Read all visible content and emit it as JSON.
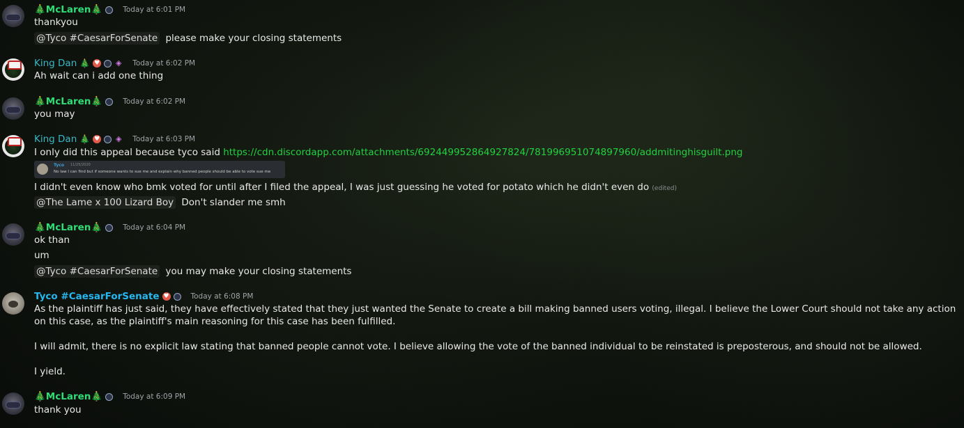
{
  "users": {
    "mclaren": {
      "name": "🎄McLaren🎄",
      "color": "#2fdc75"
    },
    "kingdan": {
      "name": "King Dan",
      "color": "#37b8c6"
    },
    "tyco": {
      "name": "Tyco #CaesarForSenate",
      "color": "#27b6ee"
    }
  },
  "messages": [
    {
      "author": "mclaren",
      "timestamp": "Today at 6:01 PM",
      "lines": [
        "thankyou"
      ],
      "mention_line": {
        "mention": "@Tyco #CaesarForSenate",
        "text": "please make your closing statements"
      }
    },
    {
      "author": "kingdan",
      "timestamp": "Today at 6:02 PM",
      "lines": [
        "Ah wait can i add one thing"
      ]
    },
    {
      "author": "mclaren",
      "timestamp": "Today at 6:02 PM",
      "lines": [
        "you may"
      ]
    },
    {
      "author": "kingdan",
      "timestamp": "Today at 6:03 PM",
      "text_prefix": "I only did this appeal because tyco said",
      "link": "https://cdn.discordapp.com/attachments/692449952864927824/781996951074897960/addmitinghisguilt.png",
      "embed": {
        "name": "Tyco",
        "time": "11/25/2020",
        "text": "No law I can find but if someone wants to sue me and explain why banned people should be able to vote sue me"
      },
      "line2": "I didn't even know who bmk voted for until after I filed the appeal, I was just guessing he voted for potato which he didn't even do",
      "edited": "(edited)",
      "mention_line": {
        "mention": "@The Lame x 100 Lizard Boy",
        "text": "Don't slander me smh"
      }
    },
    {
      "author": "mclaren",
      "timestamp": "Today at 6:04 PM",
      "lines": [
        "ok than",
        "um"
      ],
      "mention_line": {
        "mention": "@Tyco #CaesarForSenate",
        "text": "you may make your closing statements"
      }
    },
    {
      "author": "tyco",
      "timestamp": "Today at 6:08 PM",
      "paragraphs": [
        "As the plaintiff has just said, they have effectively stated that they just wanted the Senate to create a bill making banned users voting, illegal. I believe the Lower Court should not take any action on this case, as the plaintiff's main reasoning for this case has been fulfilled.",
        "I will admit, there is no explicit law stating that banned people cannot vote. I believe allowing the vote of the banned individual to be reinstated is preposterous, and should not be allowed.",
        "I yield."
      ]
    },
    {
      "author": "mclaren",
      "timestamp": "Today at 6:09 PM",
      "lines": [
        "thank you"
      ]
    }
  ]
}
